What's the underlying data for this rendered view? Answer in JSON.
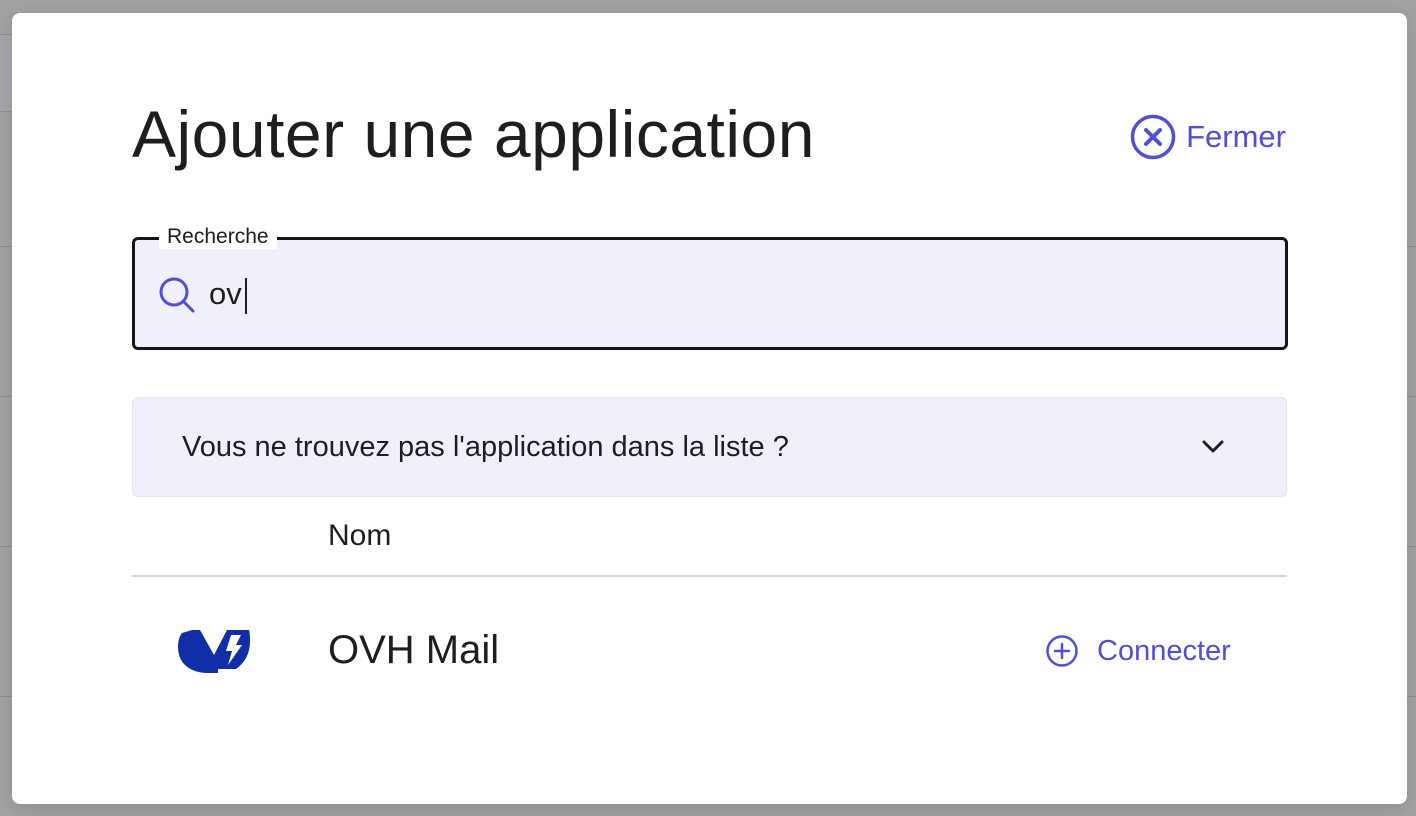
{
  "modal": {
    "title": "Ajouter une application",
    "close_label": "Fermer"
  },
  "search": {
    "legend": "Recherche",
    "value": "ov",
    "placeholder": ""
  },
  "accordion": {
    "label": "Vous ne trouvez pas l'application dans la liste ?"
  },
  "table": {
    "columns": [
      "Nom"
    ],
    "rows": [
      {
        "name": "OVH Mail",
        "logo": "ovh-logo",
        "action_label": "Connecter"
      }
    ]
  },
  "colors": {
    "accent": "#4f4fd8",
    "input_bg": "#f0f0fb",
    "ovh_blue": "#0f2ea8"
  }
}
